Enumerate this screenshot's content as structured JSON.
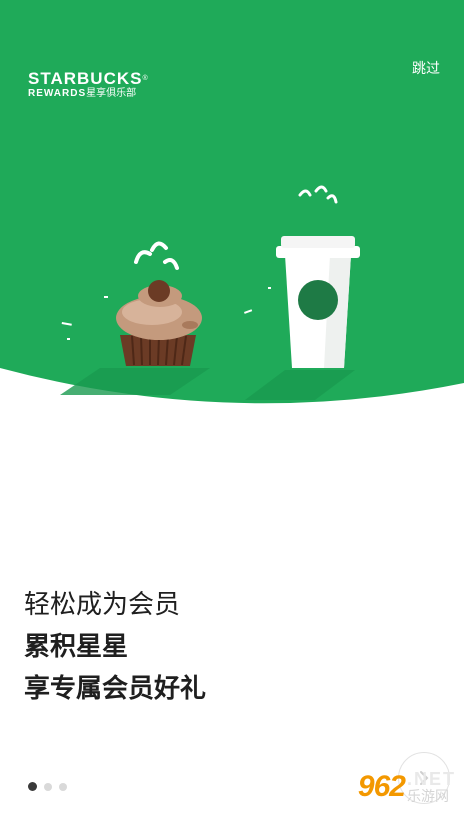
{
  "brand": {
    "name": "STARBUCKS",
    "sub": "REWARDS",
    "sub_cn": "星享俱乐部"
  },
  "header": {
    "skip_label": "跳过"
  },
  "hero": {
    "background_color": "#1faa59",
    "cup_logo_color": "#1e7a45"
  },
  "headline": {
    "line1": "轻松成为会员",
    "line2": "累积星星",
    "line3": "享专属会员好礼"
  },
  "pager": {
    "total": 3,
    "active_index": 0
  },
  "watermark": {
    "logo": "962",
    "net": ".NET",
    "cn": "乐游网"
  }
}
